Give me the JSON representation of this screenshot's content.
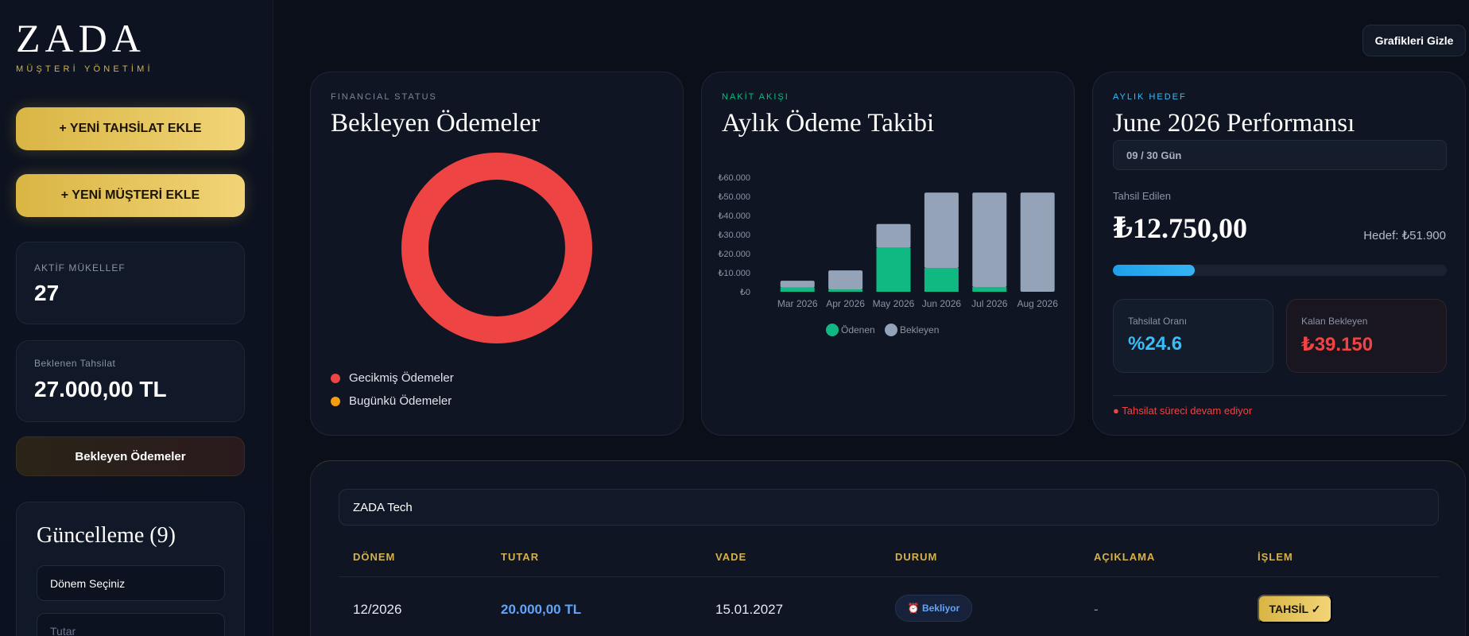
{
  "brand": {
    "name": "ZADA",
    "subtitle": "MÜŞTERİ YÖNETİMİ"
  },
  "sidebar": {
    "add_payment_label": "+ YENİ TAHSİLAT EKLE",
    "add_customer_label": "+ YENİ MÜŞTERİ EKLE",
    "active_taxpayer": {
      "label": "AKTİF MÜKELLEF",
      "value": "27"
    },
    "expected_collection": {
      "label": "Beklenen Tahsilat",
      "value": "27.000,00 TL"
    },
    "pending_button_label": "Bekleyen Ödemeler",
    "update": {
      "title": "Güncelleme (9)",
      "period_select": "Dönem Seçiniz",
      "amount_placeholder": "Tutar"
    }
  },
  "header": {
    "hide_charts_label": "Grafikleri Gizle"
  },
  "pending_card": {
    "kicker": "FINANCIAL STATUS",
    "title": "Bekleyen Ödemeler",
    "legend": [
      {
        "label": "Gecikmiş Ödemeler",
        "color": "#ef4444"
      },
      {
        "label": "Bugünkü Ödemeler",
        "color": "#f59e0b"
      }
    ]
  },
  "cash_card": {
    "kicker": "NAKİT AKIŞI",
    "title": "Aylık Ödeme Takibi"
  },
  "chart_data": [
    {
      "type": "pie",
      "categories": [
        "Gecikmiş Ödemeler",
        "Bugünkü Ödemeler"
      ],
      "values": [
        1,
        0
      ],
      "colors": [
        "#ef4444",
        "#f59e0b"
      ],
      "legend": "bottom-left"
    },
    {
      "type": "bar",
      "stacked": true,
      "categories": [
        "Mar 2026",
        "Apr 2026",
        "May 2026",
        "Jun 2026",
        "Jul 2026",
        "Aug 2026"
      ],
      "series": [
        {
          "name": "Ödenen",
          "color": "#10b981",
          "values": [
            2200,
            1200,
            23000,
            12500,
            2500,
            0
          ]
        },
        {
          "name": "Bekleyen",
          "color": "#94a3b8",
          "values": [
            3600,
            10000,
            12500,
            39500,
            49500,
            52000
          ]
        }
      ],
      "yticks": [
        "₺0",
        "₺10.000",
        "₺20.000",
        "₺30.000",
        "₺40.000",
        "₺50.000",
        "₺60.000"
      ],
      "ylim": [
        0,
        60000
      ],
      "legend": "bottom-center",
      "grid": false
    }
  ],
  "performance": {
    "kicker": "AYLIK HEDEF",
    "title": "June 2026 Performansı",
    "days": "09 / 30 Gün",
    "collected_label": "Tahsil Edilen",
    "collected_value": "₺12.750,00",
    "target": "Hedef: ₺51.900",
    "progress_fraction": 0.246,
    "rate_label": "Tahsilat Oranı",
    "rate_value": "%24.6",
    "remaining_label": "Kalan Bekleyen",
    "remaining_value": "₺39.150",
    "status": "● Tahsilat süreci devam ediyor"
  },
  "table": {
    "search_value": "ZADA Tech",
    "headers": [
      "DÖNEM",
      "TUTAR",
      "VADE",
      "DURUM",
      "AÇIKLAMA",
      "İŞLEM"
    ],
    "rows": [
      {
        "period": "12/2026",
        "amount": "20.000,00 TL",
        "due": "15.01.2027",
        "status": "⏰ Bekliyor",
        "description": "-",
        "action": "TAHSİL ✓"
      }
    ]
  },
  "colors": {
    "accent_gold": "#d4b24c",
    "paid": "#10b981",
    "pending": "#94a3b8",
    "overdue": "#ef4444",
    "info": "#38bdf8"
  }
}
